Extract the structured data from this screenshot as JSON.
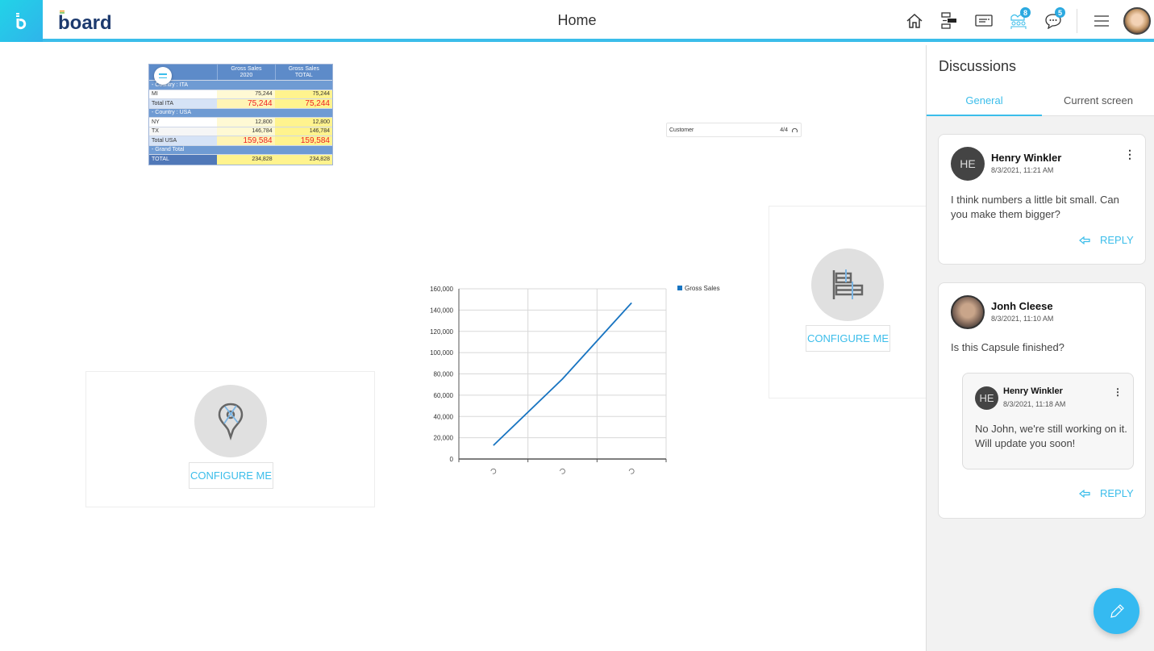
{
  "header": {
    "title": "Home",
    "logo_text": "board",
    "icons": [
      {
        "name": "home-icon"
      },
      {
        "name": "tree-nav-icon"
      },
      {
        "name": "card-icon"
      },
      {
        "name": "collaborators-icon",
        "badge": "8"
      },
      {
        "name": "chat-icon",
        "badge": "5"
      },
      {
        "name": "hamburger-menu-icon"
      }
    ]
  },
  "table": {
    "headers": [
      "",
      "Gross Sales 2020",
      "Gross Sales TOTAL"
    ],
    "header_lines": [
      [
        "Gross Sales",
        "2020"
      ],
      [
        "Gross Sales",
        "TOTAL"
      ]
    ],
    "groups": [
      {
        "label": "-  Country : ITA",
        "rows": [
          {
            "name": "MI",
            "v2020": "75,244",
            "vtotal": "75,244"
          }
        ],
        "total": {
          "name": "Total ITA",
          "v2020": "75,244",
          "vtotal": "75,244"
        }
      },
      {
        "label": "-  Country : USA",
        "rows": [
          {
            "name": "NY",
            "v2020": "12,800",
            "vtotal": "12,800"
          },
          {
            "name": "TX",
            "v2020": "146,784",
            "vtotal": "146,784"
          }
        ],
        "total": {
          "name": "Total USA",
          "v2020": "159,584",
          "vtotal": "159,584"
        }
      }
    ],
    "grand_total_label": "-  Grand Total",
    "grand_total": {
      "name": "TOTAL",
      "v2020": "234,828",
      "vtotal": "234,828"
    }
  },
  "selector": {
    "label": "Customer",
    "count": "4/4"
  },
  "configure_label": "CONFIGURE ME",
  "chart_data": {
    "type": "line",
    "title": "",
    "categories": [
      "",
      "",
      ""
    ],
    "series": [
      {
        "name": "Gross Sales",
        "color": "#1874c1",
        "values": [
          12800,
          75244,
          146784
        ]
      }
    ],
    "yticks": [
      "0",
      "20,000",
      "40,000",
      "60,000",
      "80,000",
      "100,000",
      "120,000",
      "140,000",
      "160,000"
    ],
    "ylim": [
      0,
      160000
    ],
    "grid": true,
    "legend": "top-right",
    "xlabel": "",
    "ylabel": ""
  },
  "discussions": {
    "title": "Discussions",
    "tabs": [
      "General",
      "Current screen"
    ],
    "active_tab": "General",
    "threads": [
      {
        "initials": "HE",
        "author": "Henry Winkler",
        "date": "8/3/2021, 11:21 AM",
        "message": "I think numbers a little bit small. Can you make them bigger?",
        "reply_label": "REPLY"
      },
      {
        "initials": "",
        "author": "Jonh Cleese",
        "date": "8/3/2021, 11:10 AM",
        "message": "Is this Capsule finished?",
        "reply_label": "REPLY",
        "replies": [
          {
            "initials": "HE",
            "author": "Henry Winkler",
            "date": "8/3/2021, 11:18 AM",
            "message": "No John, we're still working on it. Will update you soon!"
          }
        ]
      }
    ]
  },
  "colors": {
    "accent": "#3bbdea",
    "line": "#1874c1",
    "negative_highlight": "#e22222"
  }
}
